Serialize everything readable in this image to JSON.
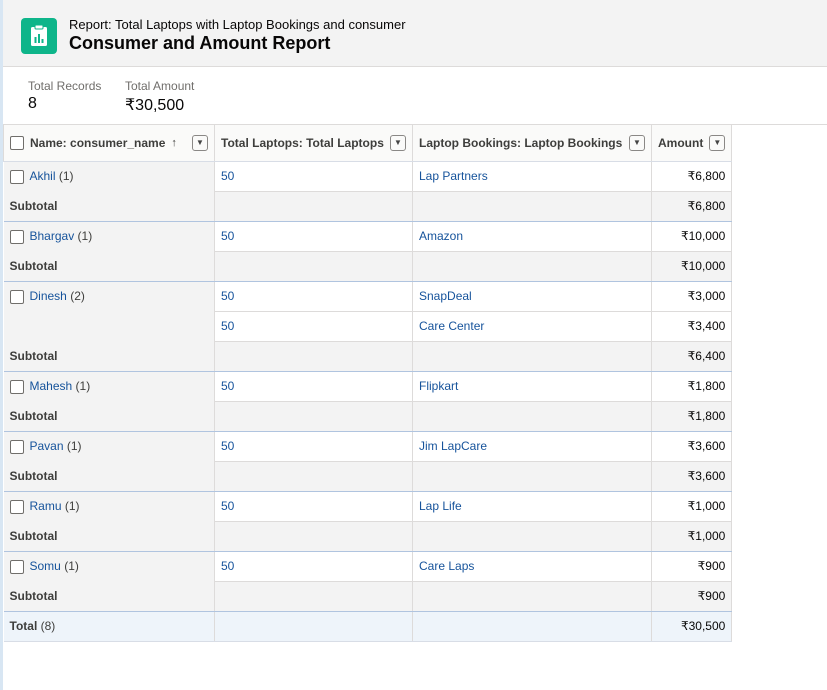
{
  "header": {
    "subtitle": "Report: Total Laptops with Laptop Bookings and consumer",
    "title": "Consumer and Amount Report"
  },
  "summary": {
    "total_records_label": "Total Records",
    "total_records_value": "8",
    "total_amount_label": "Total Amount",
    "total_amount_value": "₹30,500"
  },
  "table": {
    "columns": [
      {
        "label": "Name: consumer_name",
        "sort": "↑"
      },
      {
        "label": "Total Laptops: Total Laptops"
      },
      {
        "label": "Laptop Bookings: Laptop Bookings"
      },
      {
        "label": "Amount"
      }
    ],
    "groups": [
      {
        "name": "Akhil",
        "count": "(1)",
        "rows": [
          {
            "laptops": "50",
            "booking": "Lap Partners",
            "amount": "₹6,800"
          }
        ],
        "subtotal": "₹6,800"
      },
      {
        "name": "Bhargav",
        "count": "(1)",
        "rows": [
          {
            "laptops": "50",
            "booking": "Amazon",
            "amount": "₹10,000"
          }
        ],
        "subtotal": "₹10,000"
      },
      {
        "name": "Dinesh",
        "count": "(2)",
        "rows": [
          {
            "laptops": "50",
            "booking": "SnapDeal",
            "amount": "₹3,000"
          },
          {
            "laptops": "50",
            "booking": "Care Center",
            "amount": "₹3,400"
          }
        ],
        "subtotal": "₹6,400"
      },
      {
        "name": "Mahesh",
        "count": "(1)",
        "rows": [
          {
            "laptops": "50",
            "booking": "Flipkart",
            "amount": "₹1,800"
          }
        ],
        "subtotal": "₹1,800"
      },
      {
        "name": "Pavan",
        "count": "(1)",
        "rows": [
          {
            "laptops": "50",
            "booking": "Jim LapCare",
            "amount": "₹3,600"
          }
        ],
        "subtotal": "₹3,600"
      },
      {
        "name": "Ramu",
        "count": "(1)",
        "rows": [
          {
            "laptops": "50",
            "booking": "Lap Life",
            "amount": "₹1,000"
          }
        ],
        "subtotal": "₹1,000"
      },
      {
        "name": "Somu",
        "count": "(1)",
        "rows": [
          {
            "laptops": "50",
            "booking": "Care Laps",
            "amount": "₹900"
          }
        ],
        "subtotal": "₹900"
      }
    ],
    "subtotal_label": "Subtotal",
    "total_label": "Total",
    "total_count": "(8)",
    "total_amount": "₹30,500"
  },
  "icons": {
    "report": "report-clipboard-icon",
    "dropdown": "chevron-down-icon",
    "sort": "sort-ascending-icon"
  },
  "colors": {
    "icon_bg": "#0eb58a",
    "link": "#16539b",
    "subtotal_bg": "#f3f3f3",
    "total_bg": "#eef4fa"
  }
}
